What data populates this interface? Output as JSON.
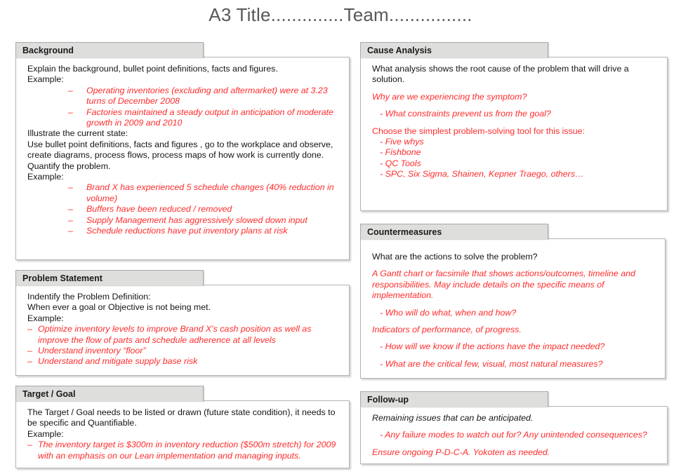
{
  "document": {
    "title": "A3 Title..............Team................"
  },
  "colors": {
    "accent_red": "#ff2b2b",
    "header_gray": "#dededd",
    "title_gray": "#58585a",
    "body_text": "#141414"
  },
  "sections": {
    "background": {
      "header": "Background",
      "lines": [
        "Explain the background,  bullet point definitions, facts and figures.",
        "Example:"
      ],
      "bullets_1": [
        "Operating inventories (excluding and aftermarket) were at 3.23 turns of December 2008",
        "Factories maintained a steady output in anticipation of moderate growth in 2009 and 2010"
      ],
      "lines_2": [
        "Illustrate the current state:",
        "Use bullet point definitions, facts and figures  , go to the workplace and observe, create diagrams, process flows, process maps of how work is currently done.",
        "Quantify the problem.",
        "Example:"
      ],
      "bullets_2": [
        "Brand X has experienced  5 schedule changes (40% reduction in volume)",
        "Buffers have been reduced / removed",
        "Supply Management  has aggressively  slowed down  input",
        "Schedule reductions have put inventory plans at risk"
      ]
    },
    "problem_statement": {
      "header": "Problem Statement",
      "lines": [
        "Indentify  the Problem Definition:",
        "When ever  a goal or Objective  is not being met.",
        "Example:"
      ],
      "bullets": [
        "Optimize inventory  levels to improve  Brand X's cash position as well as improve  the flow of parts and schedule adherence  at all levels",
        "Understand  inventory  “floor”",
        "Understand  and mitigate supply base risk"
      ]
    },
    "target_goal": {
      "header": "Target / Goal",
      "lines": [
        "The Target  / Goal needs to be  listed or  drawn (future  state condition), it needs to be  specific and Quantifiable.",
        "Example:"
      ],
      "bullets": [
        "The inventory  target is $300m in inventory  reduction  ($500m stretch) for 2009 with an emphasis on our Lean  implementation  and managing inputs."
      ]
    },
    "cause_analysis": {
      "header": "Cause Analysis",
      "intro": "What analysis shows the root cause of the problem that will drive  a solution.",
      "question_1": "Why are we experiencing  the symptom?",
      "sub_1": "- What constraints prevent  us from  the goal?",
      "prompt": "Choose the simplest problem-solving  tool for this issue:",
      "tools": [
        "- Five whys",
        "- Fishbone",
        "- QC Tools",
        "- SPC, Six Sigma, Shainen, Kepner Traego,  others…"
      ]
    },
    "countermeasures": {
      "header": "Countermeasures",
      "intro": "What are the actions to solve the problem?",
      "italic_block": "A Gantt chart or facsimile that shows  actions/outcomes, timeline  and responsibilities. May  include details on the specific means of implementation.",
      "sub_1": "- Who will  do what, when  and how?",
      "italic_2": "Indicators of performance,  of progress.",
      "sub_2": "- How  will  we  know if the actions have  the impact needed?",
      "sub_3": "- What are  the critical few, visual,  most natural  measures?"
    },
    "follow_up": {
      "header": "Follow-up",
      "line_dark": "Remaining  issues that can be anticipated.",
      "sub_1": "- Any failure  modes to watch out for? Any unintended  consequences?",
      "line_red": "Ensure ongoing P-D-C-A.  Yokoten as needed."
    }
  }
}
